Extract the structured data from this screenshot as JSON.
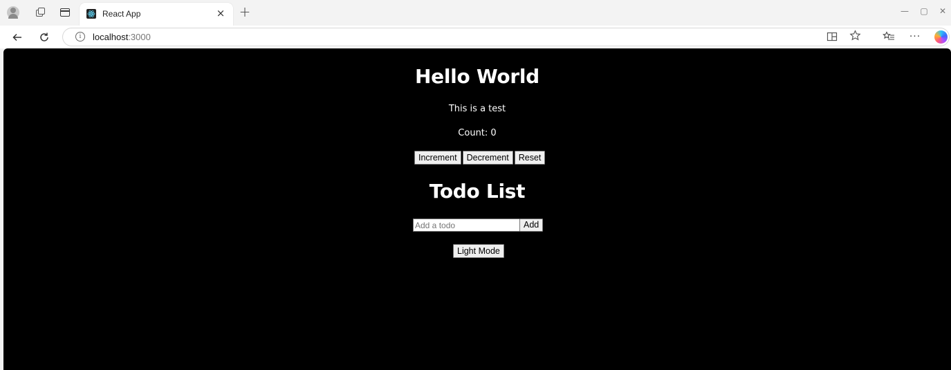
{
  "browser": {
    "tab": {
      "title": "React App",
      "close_glyph": "×"
    },
    "new_tab_glyph": "+",
    "window_controls": {
      "minimize": "—",
      "maximize": "▢",
      "close": "✕"
    },
    "address": {
      "host": "localhost",
      "port": ":3000"
    },
    "icons": {
      "profile": "profile-icon",
      "workspaces": "workspaces-icon",
      "sidebar": "sidebar-toggle-icon",
      "back": "back-arrow-icon",
      "reload": "reload-icon",
      "info": "site-info-icon",
      "split": "split-screen-icon",
      "favorite": "star-icon",
      "favorites": "favorites-icon",
      "more": "more-icon",
      "copilot": "copilot-icon"
    }
  },
  "page": {
    "background": "#000000",
    "text_color": "#ffffff",
    "title": "Hello World",
    "subtitle": "This is a test",
    "count_label": "Count: 0",
    "counter_buttons": {
      "increment": "Increment",
      "decrement": "Decrement",
      "reset": "Reset"
    },
    "todo": {
      "heading": "Todo List",
      "input_value": "",
      "input_placeholder": "Add a todo",
      "add_label": "Add"
    },
    "mode_toggle_label": "Light Mode"
  }
}
